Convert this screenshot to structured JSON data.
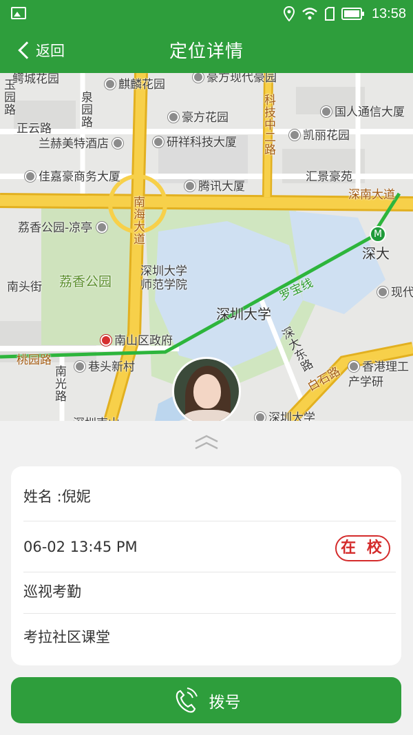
{
  "status_bar": {
    "time": "13:58",
    "icons": [
      "image-icon",
      "location-icon",
      "wifi-icon",
      "sim-icon",
      "battery-icon"
    ]
  },
  "header": {
    "back_label": "返回",
    "title": "定位详情"
  },
  "map": {
    "labels": {
      "l1": "鳄城花园",
      "l2": "麒麟花园",
      "l3": "豪方现代豪园",
      "l4": "玉园路",
      "l5": "泉园路",
      "l6": "正云路",
      "l7": "豪方花园",
      "l8": "科技中二路",
      "l9": "国人通信大厦",
      "l10": "兰赫美特酒店",
      "l11": "研祥科技大厦",
      "l12": "凯丽花园",
      "l13": "佳嘉豪商务大厦",
      "l14": "腾讯大厦",
      "l15": "汇景豪苑",
      "l16": "深南大道",
      "l17": "南海大道",
      "l18": "荔香公园-凉亭",
      "l19": "深大",
      "l20": "深圳大学师范学院",
      "l21": "南头街",
      "l22": "荔香公园",
      "l23": "罗宝线",
      "l24": "深圳大学",
      "l25": "现代",
      "l26": "南山区政府",
      "l27": "深大东路",
      "l28": "桃园路",
      "l29": "巷头新村",
      "l30": "南光路",
      "l31": "白石路",
      "l32": "香港理工产学研",
      "l33": "深圳大学",
      "l34": "深圳南山"
    },
    "metro_symbol": "M",
    "colors": {
      "road_major": "#f7d04a",
      "road_edge": "#e2b020",
      "metro_line": "#2db53c",
      "water": "#cfe0f2",
      "green": "#c9e2b8"
    }
  },
  "card": {
    "name": "姓名 :倪妮",
    "time": "06-02 13:45 PM",
    "status_badge": "在 校",
    "type": "巡视考勤",
    "place": "考拉社区课堂"
  },
  "dial_button": {
    "label": "拨号"
  },
  "colors": {
    "brand": "#2e9e3c",
    "badge": "#d42b2b"
  }
}
